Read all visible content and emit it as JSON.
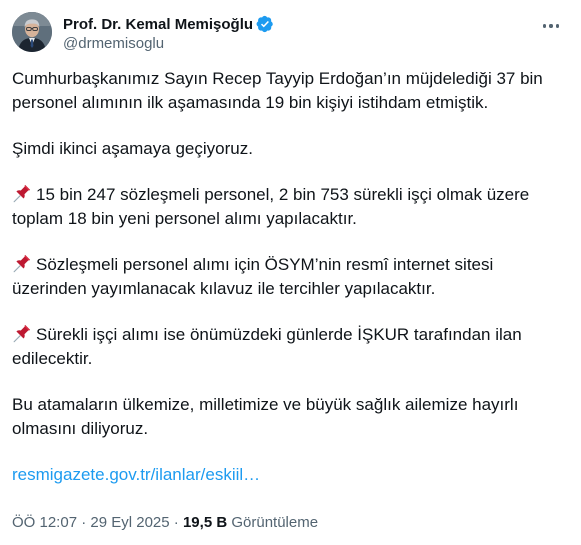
{
  "author": {
    "display_name": "Prof. Dr. Kemal Memişoğlu",
    "handle": "@drmemisoglu",
    "verified": true,
    "verified_color": "#1d9bf0"
  },
  "tweet": {
    "paragraphs": [
      {
        "lines": [
          "Cumhurbaşkanımız Sayın Recep Tayyip Erdoğan’ın müjdelediği 37 bin",
          "personel alımının ilk aşamasında 19 bin kişiyi istihdam etmiştik."
        ]
      },
      {
        "lines": [
          "Şimdi ikinci aşamaya geçiyoruz."
        ]
      },
      {
        "icon": "pushpin-icon",
        "lines": [
          "15 bin 247 sözleşmeli personel, 2 bin 753 sürekli işçi olmak üzere",
          "toplam 18 bin yeni personel alımı yapılacaktır."
        ]
      },
      {
        "icon": "pushpin-icon",
        "lines": [
          "Sözleşmeli personel alımı için ÖSYM’nin resmî internet sitesi",
          "üzerinden yayımlanacak kılavuz ile tercihler yapılacaktır."
        ]
      },
      {
        "icon": "pushpin-icon",
        "lines": [
          "Sürekli işçi alımı ise önümüzdeki günlerde İŞKUR tarafından ilan",
          "edilecektir."
        ]
      },
      {
        "lines": [
          "Bu atamaların ülkemize, milletimize ve büyük sağlık ailemize hayırlı",
          "olmasını diliyoruz."
        ]
      }
    ],
    "link_text": "resmigazete.gov.tr/ilanlar/eskiil…",
    "link_color": "#1d9bf0"
  },
  "meta": {
    "time": "ÖÖ 12:07",
    "separator": "·",
    "date": "29 Eyl 2025",
    "views_count": "19,5 B",
    "views_label": "Görüntüleme"
  }
}
